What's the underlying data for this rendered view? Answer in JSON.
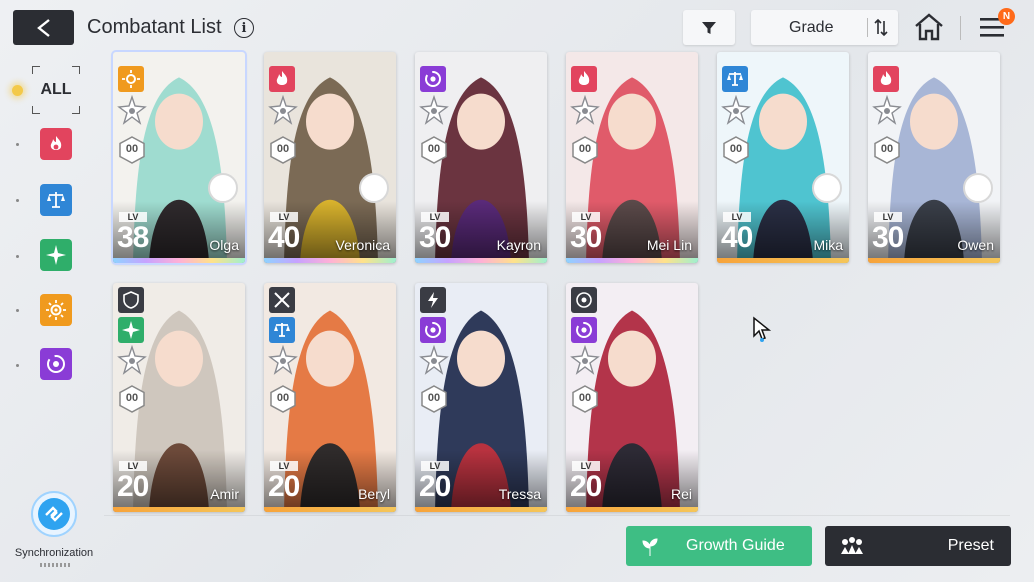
{
  "header": {
    "title": "Combatant List",
    "info_icon": "i",
    "grade_label": "Grade",
    "notification_count": "N"
  },
  "sidebar": {
    "all_label": "ALL",
    "elements": [
      {
        "name": "fire",
        "color": "#e2445e"
      },
      {
        "name": "balance",
        "color": "#2f86d6"
      },
      {
        "name": "wind",
        "color": "#2fae6a"
      },
      {
        "name": "sun",
        "color": "#f09a1e"
      },
      {
        "name": "void",
        "color": "#8a3cd6"
      }
    ],
    "sync_label": "Synchronization"
  },
  "cards": [
    {
      "name": "Olga",
      "lv_tag": "LV",
      "level": "38",
      "element": "sun",
      "badge": "00",
      "strip": "rainbow",
      "companion": true
    },
    {
      "name": "Veronica",
      "lv_tag": "LV",
      "level": "40",
      "element": "fire",
      "badge": "00",
      "strip": "rainbow",
      "companion": true
    },
    {
      "name": "Kayron",
      "lv_tag": "LV",
      "level": "30",
      "element": "void",
      "badge": "00",
      "strip": "rainbow",
      "companion": false
    },
    {
      "name": "Mei Lin",
      "lv_tag": "LV",
      "level": "30",
      "element": "fire",
      "badge": "00",
      "strip": "rainbow",
      "companion": false
    },
    {
      "name": "Mika",
      "lv_tag": "LV",
      "level": "40",
      "element": "balance",
      "badge": "00",
      "strip": "orange",
      "companion": true
    },
    {
      "name": "Owen",
      "lv_tag": "LV",
      "level": "30",
      "element": "fire",
      "badge": "00",
      "strip": "orange",
      "companion": true
    },
    {
      "name": "Amir",
      "lv_tag": "LV",
      "level": "20",
      "element": "wind",
      "class": "shield",
      "badge": "00",
      "strip": "orange",
      "companion": false
    },
    {
      "name": "Beryl",
      "lv_tag": "LV",
      "level": "20",
      "element": "balance",
      "class": "crossed-swords",
      "badge": "00",
      "strip": "orange",
      "companion": false
    },
    {
      "name": "Tressa",
      "lv_tag": "LV",
      "level": "20",
      "element": "void",
      "class": "lightning",
      "badge": "00",
      "strip": "orange",
      "companion": false
    },
    {
      "name": "Rei",
      "lv_tag": "LV",
      "level": "20",
      "element": "void",
      "class": "target",
      "badge": "00",
      "strip": "orange",
      "companion": false
    }
  ],
  "footer": {
    "growth_guide_label": "Growth Guide",
    "preset_label": "Preset"
  },
  "colors": {
    "fire": "#e2445e",
    "balance": "#2f86d6",
    "wind": "#2fae6a",
    "sun": "#f09a1e",
    "void": "#8a3cd6",
    "growth": "#3ebe84",
    "dark": "#2b2d33"
  }
}
